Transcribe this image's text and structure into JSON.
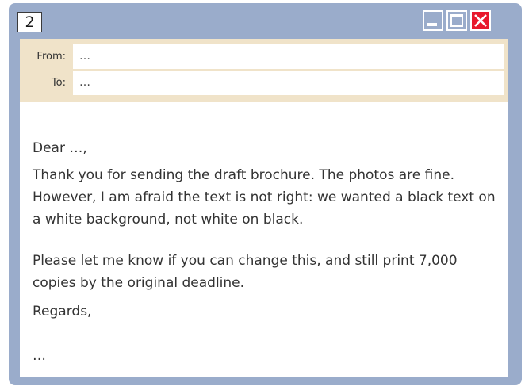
{
  "window": {
    "number": "2",
    "colors": {
      "frame": "#9aaccb",
      "header": "#f0e3c9",
      "close": "#e8192c"
    },
    "controls": {
      "minimize": "minimize-icon",
      "maximize": "maximize-icon",
      "close": "close-icon"
    }
  },
  "header": {
    "from_label": "From:",
    "from_value": "…",
    "to_label": "To:",
    "to_value": "…"
  },
  "body": {
    "greeting": "Dear …,",
    "paragraph1": "Thank you for sending the draft brochure. The photos are fine. However, I am afraid the text is not right: we wanted a black text on a white background, not white on black.",
    "paragraph2": "Please let me know if you can change this, and still print 7,000 copies by the original deadline.",
    "closing": "Regards,",
    "signature": "…"
  }
}
